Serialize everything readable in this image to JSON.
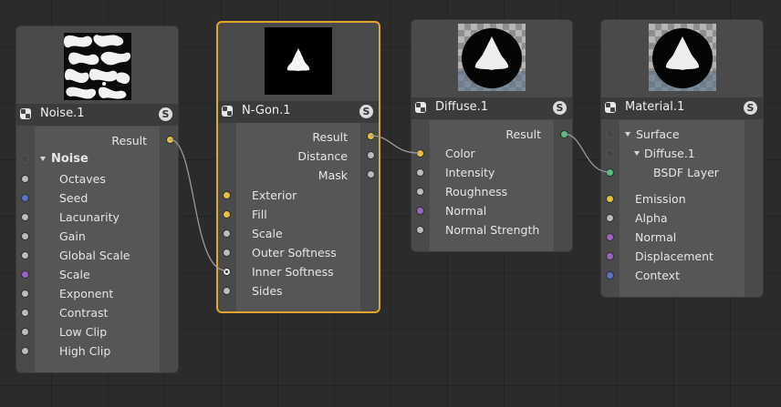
{
  "colors": {
    "selected_border": "#e3a52e",
    "port_yellow": "#e7c13c",
    "port_blue": "#5b74c9",
    "port_purple": "#9a63c8",
    "port_green": "#4fc27f",
    "port_gray": "#bcbcbc",
    "wire": "#9a9a9a"
  },
  "nodes": {
    "noise": {
      "title": "Noise.1",
      "solo": "S",
      "output": "Result",
      "group": "Noise",
      "inputs": [
        "Octaves",
        "Seed",
        "Lacunarity",
        "Gain",
        "Global Scale",
        "Scale",
        "Exponent",
        "Contrast",
        "Low Clip",
        "High Clip"
      ]
    },
    "ngon": {
      "title": "N-Gon.1",
      "solo": "S",
      "outputs": [
        "Result",
        "Distance",
        "Mask"
      ],
      "inputs": [
        "Exterior",
        "Fill",
        "Scale",
        "Outer Softness",
        "Inner Softness",
        "Sides"
      ]
    },
    "diffuse": {
      "title": "Diffuse.1",
      "solo": "S",
      "output": "Result",
      "inputs": [
        "Color",
        "Intensity",
        "Roughness",
        "Normal",
        "Normal Strength"
      ]
    },
    "material": {
      "title": "Material.1",
      "solo": "S",
      "surface": "Surface",
      "surface_child": "Diffuse.1",
      "surface_layer": "BSDF Layer",
      "inputs": [
        "Emission",
        "Alpha",
        "Normal",
        "Displacement",
        "Context"
      ]
    }
  }
}
